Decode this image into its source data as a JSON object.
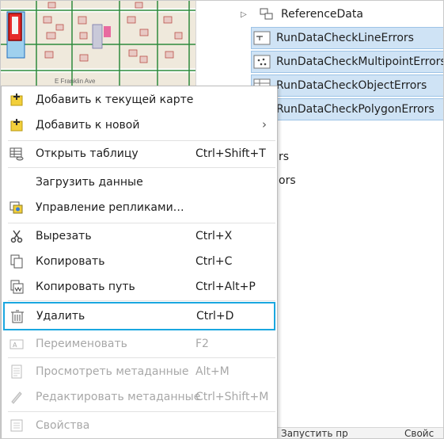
{
  "tree": {
    "reference_data": "ReferenceData",
    "items": [
      "RunDataCheckLineErrors",
      "RunDataCheckMultipointErrors",
      "RunDataCheckObjectErrors",
      "RunDataCheckPolygonErrors"
    ],
    "partial_1": "rs",
    "partial_2": "ors"
  },
  "map": {
    "street_label": "E Franklin Ave"
  },
  "bottom_strip": {
    "text_1": "Запустить пр",
    "text_2": "Свойс"
  },
  "menu": {
    "add_current": "Добавить к текущей карте",
    "add_new": "Добавить к новой",
    "open_table": "Открыть таблицу",
    "open_table_sc": "Ctrl+Shift+T",
    "load_data": "Загрузить данные",
    "manage_replicas": "Управление репликами…",
    "cut": "Вырезать",
    "cut_sc": "Ctrl+X",
    "copy": "Копировать",
    "copy_sc": "Ctrl+C",
    "copy_path": "Копировать путь",
    "copy_path_sc": "Ctrl+Alt+P",
    "delete": "Удалить",
    "delete_sc": "Ctrl+D",
    "rename": "Переименовать",
    "rename_sc": "F2",
    "view_meta": "Просмотреть метаданные",
    "view_meta_sc": "Alt+M",
    "edit_meta": "Редактировать метаданные",
    "edit_meta_sc": "Ctrl+Shift+M",
    "properties": "Свойства"
  },
  "colors": {
    "accent_focus": "#1aa7e0",
    "selection": "#cfe3f5",
    "disabled_text": "#a8a8a8"
  }
}
